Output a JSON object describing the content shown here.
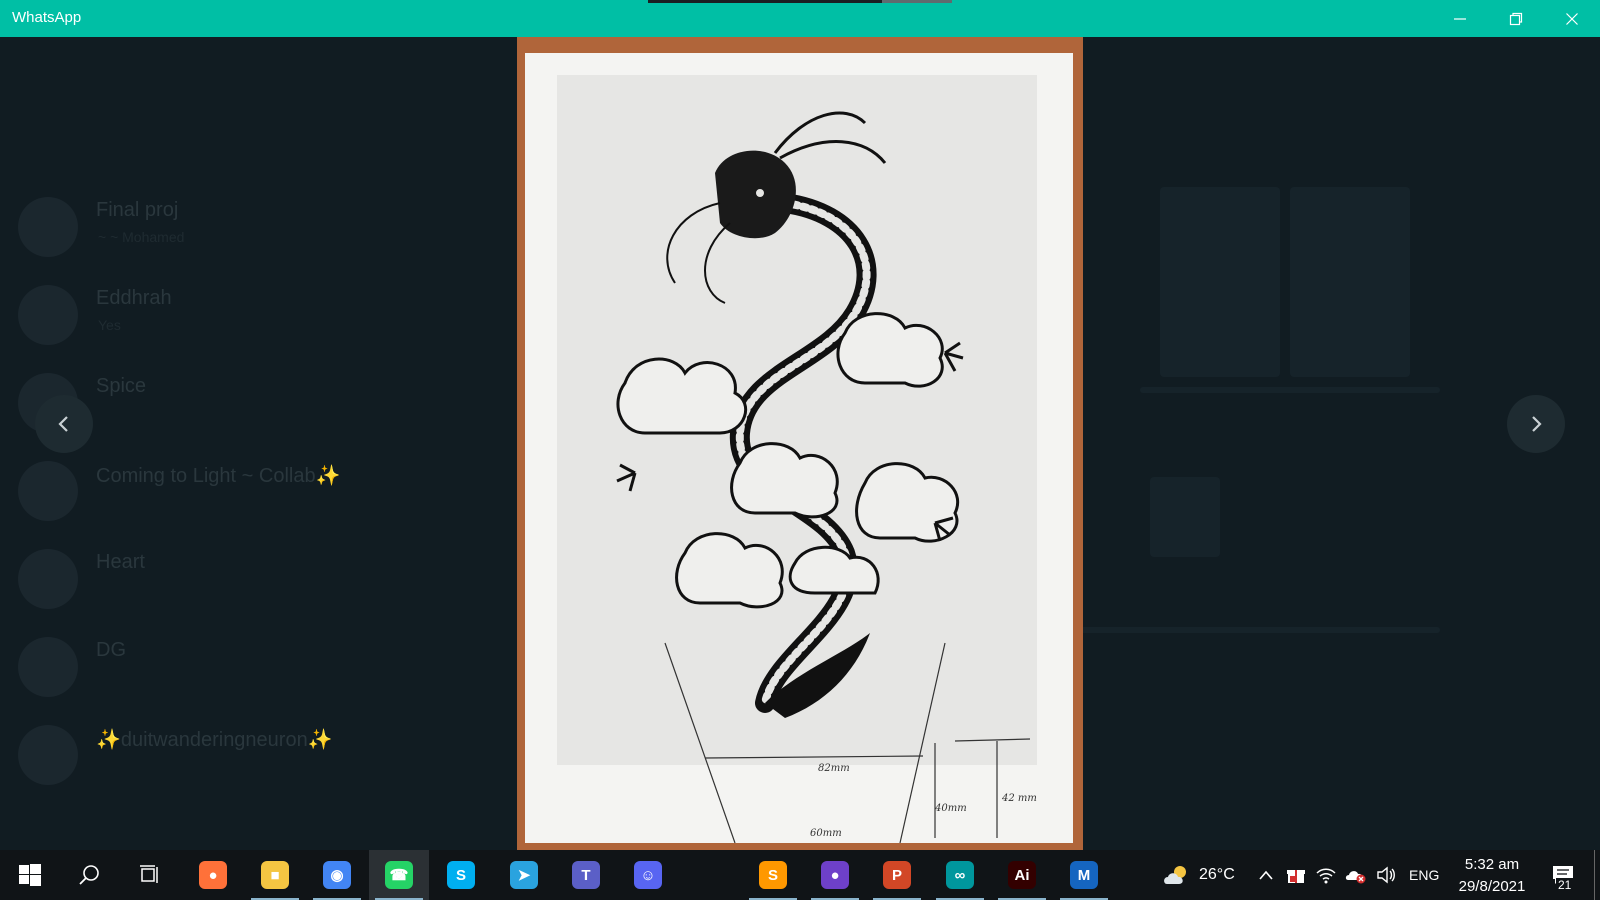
{
  "window": {
    "title": "WhatsApp",
    "accent_color": "#00bfa5",
    "load_progress": 0.77
  },
  "chatlist": {
    "items": [
      {
        "name": "Final proj",
        "sub": "~ ~ Mohamed"
      },
      {
        "name": "Eddhrah",
        "sub": "Yes"
      },
      {
        "name": "Spice",
        "sub": ""
      },
      {
        "name": "Coming to Light ~ Collab✨",
        "sub": ""
      },
      {
        "name": "Heart",
        "sub": ""
      },
      {
        "name": "DG",
        "sub": ""
      },
      {
        "name": "✨duitwanderingneuron✨",
        "sub": ""
      }
    ]
  },
  "viewer": {
    "measurements": {
      "top_width": "82mm",
      "side_height": "40mm",
      "right_height": "42 mm",
      "bottom_width": "60mm"
    },
    "prev_icon": "chevron-left-icon",
    "next_icon": "chevron-right-icon"
  },
  "taskbar": {
    "apps": [
      {
        "name": "firefox",
        "icon": "firefox-icon",
        "color": "#ff7139",
        "glyph": "●",
        "running": false,
        "active": false
      },
      {
        "name": "file-explorer",
        "icon": "folder-icon",
        "color": "#f4c542",
        "glyph": "■",
        "running": true,
        "active": false
      },
      {
        "name": "chrome",
        "icon": "chrome-icon",
        "color": "#4285f4",
        "glyph": "◉",
        "running": true,
        "active": false
      },
      {
        "name": "whatsapp",
        "icon": "whatsapp-icon",
        "color": "#25d366",
        "glyph": "☎",
        "running": true,
        "active": true
      },
      {
        "name": "skype",
        "icon": "skype-icon",
        "color": "#00aff0",
        "glyph": "S",
        "running": false,
        "active": false
      },
      {
        "name": "telegram",
        "icon": "telegram-icon",
        "color": "#2aa3df",
        "glyph": "➤",
        "running": false,
        "active": false
      },
      {
        "name": "teams",
        "icon": "teams-icon",
        "color": "#5b5fc7",
        "glyph": "T",
        "running": false,
        "active": false
      },
      {
        "name": "discord",
        "icon": "discord-icon",
        "color": "#5865f2",
        "glyph": "☺",
        "running": false,
        "active": false
      },
      {
        "name": "sublime",
        "icon": "sublime-icon",
        "color": "#ff9800",
        "glyph": "S",
        "running": true,
        "active": false
      },
      {
        "name": "github",
        "icon": "github-icon",
        "color": "#6e40c9",
        "glyph": "●",
        "running": true,
        "active": false
      },
      {
        "name": "powerpoint",
        "icon": "powerpoint-icon",
        "color": "#d24726",
        "glyph": "P",
        "running": true,
        "active": false
      },
      {
        "name": "arduino",
        "icon": "arduino-icon",
        "color": "#00979d",
        "glyph": "∞",
        "running": true,
        "active": false
      },
      {
        "name": "illustrator",
        "icon": "illustrator-icon",
        "color": "#330000",
        "glyph": "Ai",
        "running": true,
        "active": false
      },
      {
        "name": "app-m",
        "icon": "m-logo-icon",
        "color": "#1565c0",
        "glyph": "M",
        "running": true,
        "active": false
      }
    ],
    "weather_temp": "26°C",
    "language": "ENG",
    "time": "5:32 am",
    "date": "29/8/2021",
    "notification_count": "21"
  }
}
